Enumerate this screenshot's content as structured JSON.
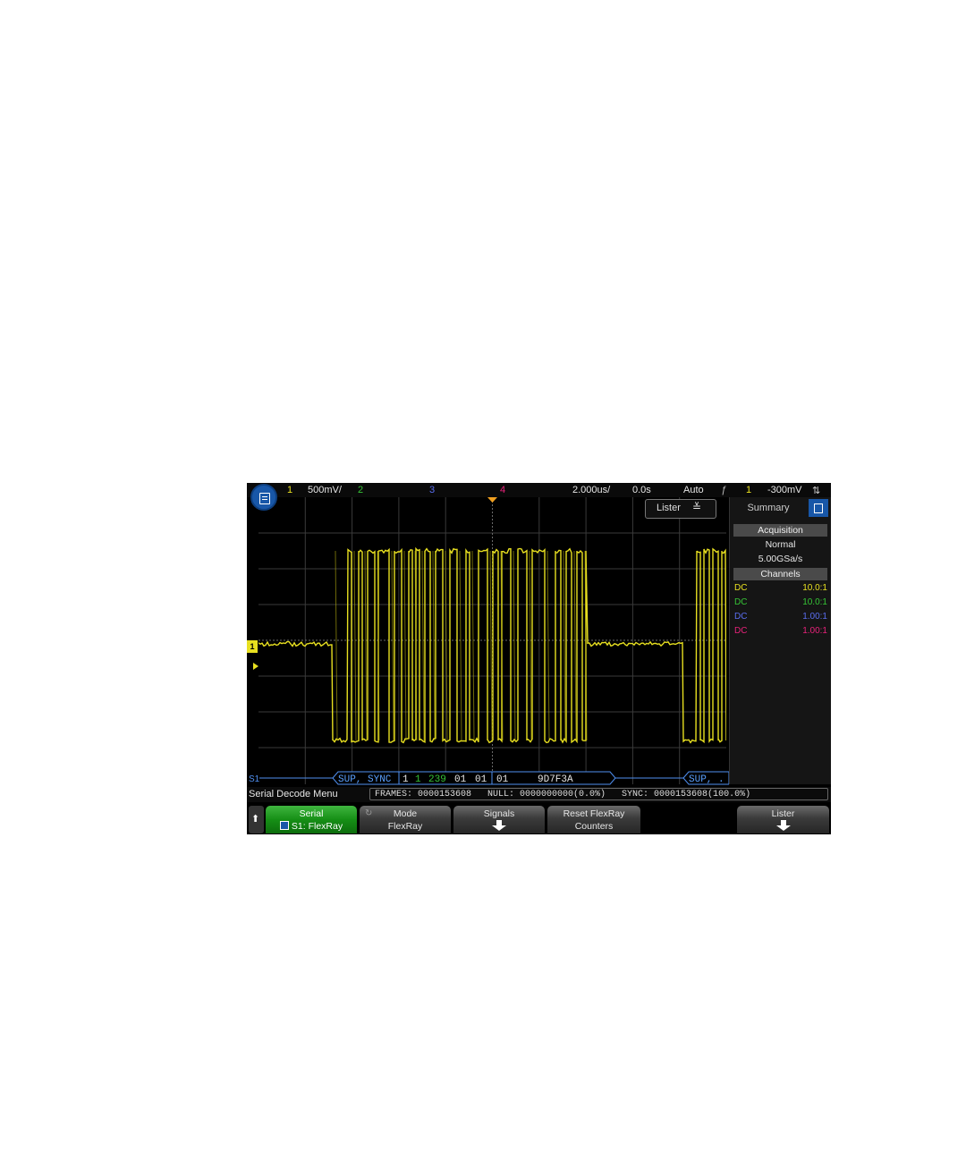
{
  "topbar": {
    "ch1_num": "1",
    "ch1_scale": "500mV/",
    "ch2_num": "2",
    "ch3_num": "3",
    "ch4_num": "4",
    "timebase": "2.000us/",
    "delay": "0.0s",
    "trigger_mode": "Auto",
    "trigger_source": "1",
    "trigger_level": "-300mV",
    "colors": {
      "ch1": "#e8e020",
      "ch2": "#36c536",
      "ch3": "#5a6ef0",
      "ch4": "#e8227a",
      "decode": "#4f8ff0"
    }
  },
  "lister_button": {
    "label": "Lister"
  },
  "sidebar": {
    "tab": "Summary",
    "acquisition_header": "Acquisition",
    "acq_mode": "Normal",
    "sample_rate": "5.00GSa/s",
    "channels_header": "Channels",
    "channels": [
      {
        "coupling": "DC",
        "probe": "10.0:1",
        "color": "#e8e020"
      },
      {
        "coupling": "DC",
        "probe": "10.0:1",
        "color": "#36c536"
      },
      {
        "coupling": "DC",
        "probe": "1.00:1",
        "color": "#5a6ef0"
      },
      {
        "coupling": "DC",
        "probe": "1.00:1",
        "color": "#e8227a"
      }
    ]
  },
  "decode": {
    "bus_label": "S1",
    "frame1": [
      "SUP, SYNC",
      "1",
      "1",
      "239",
      "01",
      "01",
      "01",
      "9D7F3A"
    ],
    "frame2": "SUP, ."
  },
  "status": {
    "menu_title": "Serial Decode Menu",
    "counters": "FRAMES: 0000153608   NULL: 0000000000(0.0%)   SYNC: 0000153608(100.0%)"
  },
  "softkeys": {
    "serial_l1": "Serial",
    "serial_l2": "S1: FlexRay",
    "mode_l1": "Mode",
    "mode_l2": "FlexRay",
    "signals": "Signals",
    "reset_l1": "Reset FlexRay",
    "reset_l2": "Counters",
    "lister": "Lister"
  }
}
